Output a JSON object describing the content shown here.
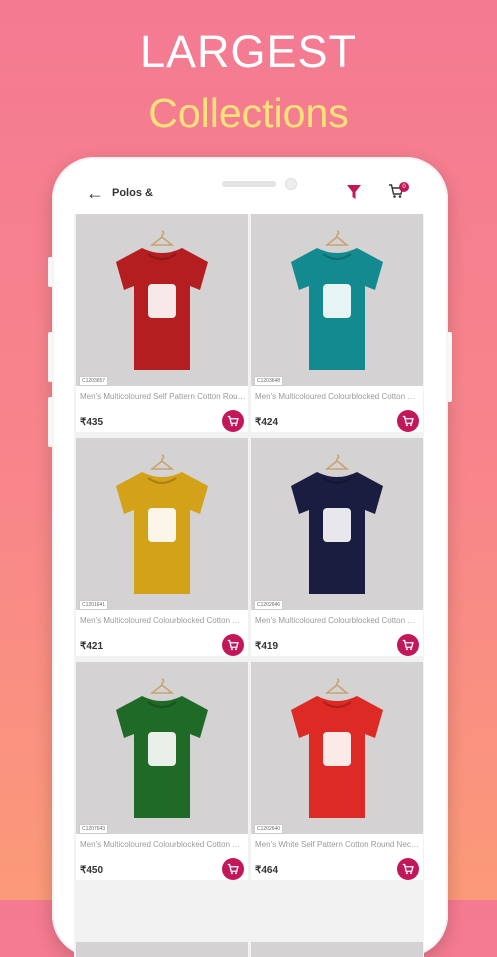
{
  "promo": {
    "line1": "LARGEST",
    "line2": "Collections"
  },
  "topbar": {
    "title": "Polos &",
    "cart_count": "0"
  },
  "products": [
    {
      "sku": "C1203657",
      "name": "Men's Multicoloured Self Pattern Cotton Round Neck T-shirt",
      "price": "₹435",
      "shirt_color": "#b51e20",
      "print_color": "#ffffff"
    },
    {
      "sku": "C1203648",
      "name": "Men's Multicoloured Colourblocked Cotton Round Neck T-shirt",
      "price": "₹424",
      "shirt_color": "#138a8f",
      "print_color": "#ffffff"
    },
    {
      "sku": "C1201641",
      "name": "Men's Multicoloured Colourblocked Cotton Round Neck T-shirt",
      "price": "₹421",
      "shirt_color": "#d4a219",
      "print_color": "#ffffff"
    },
    {
      "sku": "C1202646",
      "name": "Men's Multicoloured Colourblocked Cotton Round Neck T-shirt",
      "price": "₹419",
      "shirt_color": "#1a1d3f",
      "print_color": "#ffffff"
    },
    {
      "sku": "C1207643",
      "name": "Men's Multicoloured Colourblocked Cotton Round Neck T-shirt",
      "price": "₹450",
      "shirt_color": "#1f6a26",
      "print_color": "#ffffff"
    },
    {
      "sku": "C1202640",
      "name": "Men's White Self Pattern Cotton Round Neck T-shirt",
      "price": "₹464",
      "shirt_color": "#dd2a24",
      "print_color": "#ffffff"
    }
  ],
  "colors": {
    "accent": "#c2185b",
    "headline_yellow": "#ffe27a"
  }
}
